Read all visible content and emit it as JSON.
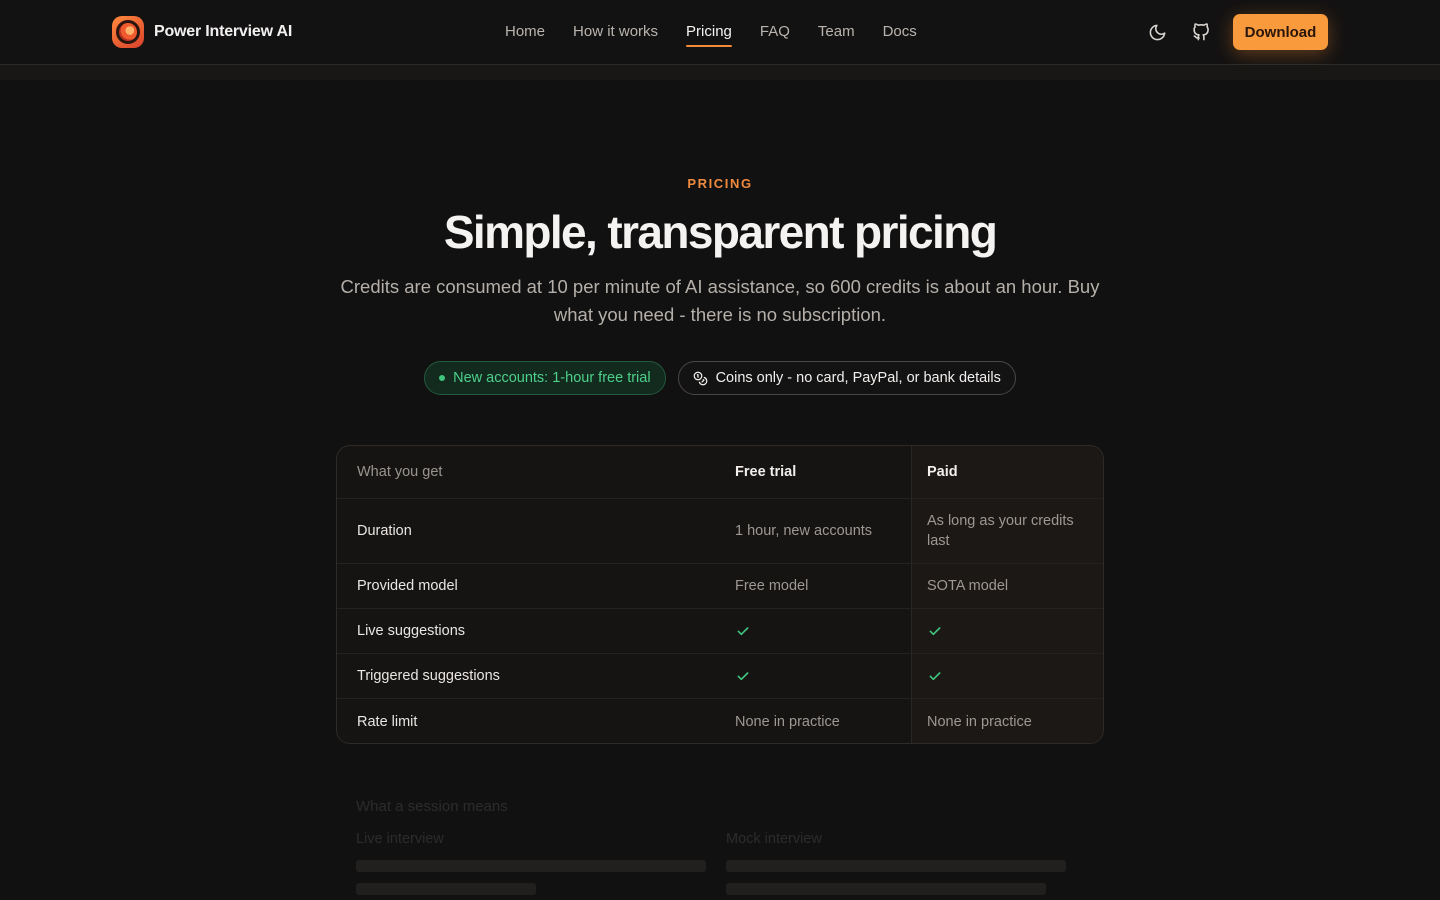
{
  "brand": {
    "name": "Power Interview AI"
  },
  "nav": {
    "items": [
      {
        "label": "Home",
        "active": false
      },
      {
        "label": "How it works",
        "active": false
      },
      {
        "label": "Pricing",
        "active": true
      },
      {
        "label": "FAQ",
        "active": false
      },
      {
        "label": "Team",
        "active": false
      },
      {
        "label": "Docs",
        "active": false
      }
    ],
    "download_label": "Download"
  },
  "hero": {
    "eyebrow": "PRICING",
    "title": "Simple, transparent pricing",
    "subtitle": "Credits are consumed at 10 per minute of AI assistance, so 600 credits is about an hour. Buy what you need - there is no subscription."
  },
  "pills": {
    "trial": "New accounts: 1-hour free trial",
    "coins": "Coins only - no card, PayPal, or bank details"
  },
  "table": {
    "headers": [
      "What you get",
      "Free trial",
      "Paid"
    ],
    "rows": [
      {
        "feature": "Duration",
        "free": "1 hour, new accounts",
        "paid": "As long as your credits last"
      },
      {
        "feature": "Provided model",
        "free": "Free model",
        "paid": "SOTA model"
      },
      {
        "feature": "Live suggestions",
        "free": "check",
        "paid": "check"
      },
      {
        "feature": "Triggered suggestions",
        "free": "check",
        "paid": "check"
      },
      {
        "feature": "Rate limit",
        "free": "None in practice",
        "paid": "None in practice"
      }
    ]
  },
  "faded_section": {
    "title": "What a session means",
    "left_heading": "Live interview",
    "right_heading": "Mock interview"
  },
  "colors": {
    "accent": "#f99a3c",
    "success": "#3fc57e",
    "background": "#121111"
  },
  "icons": {
    "theme": "moon-icon",
    "repo": "github-icon",
    "coins": "coins-icon",
    "check": "check-icon"
  }
}
